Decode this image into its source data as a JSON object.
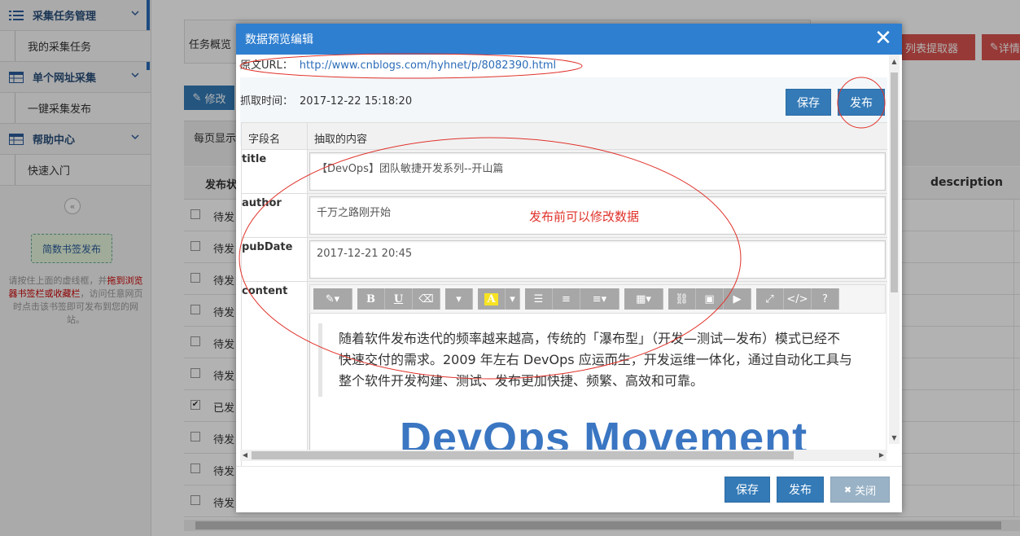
{
  "sidebar": {
    "groups": [
      {
        "label": "采集任务管理",
        "icon": "list-icon",
        "items": [
          "我的采集任务"
        ]
      },
      {
        "label": "单个网址采集",
        "icon": "table-icon",
        "items": [
          "一键采集发布"
        ]
      },
      {
        "label": "帮助中心",
        "icon": "table-icon",
        "items": [
          "快速入门"
        ]
      }
    ],
    "collapse_glyph": "«",
    "bookmark_button": "简数书签发布",
    "bookmark_tip_pre": "请按住上面的虚线框，并",
    "bookmark_tip_red": "拖到浏览器书签栏或收藏栏",
    "bookmark_tip_post": "，访问任意网页时点击该书签即可发布到您的网站。"
  },
  "background": {
    "tab_overview": "任务概览",
    "list_extractor_button": "列表提取器",
    "detail_button": "详情",
    "edit_button": "修改",
    "per_page": "每页显示",
    "header_status": "发布状",
    "header_description": "description",
    "rows": [
      {
        "status": "待发",
        "checked": false
      },
      {
        "status": "待发",
        "checked": false
      },
      {
        "status": "待发",
        "checked": false
      },
      {
        "status": "待发",
        "checked": false
      },
      {
        "status": "待发",
        "checked": false
      },
      {
        "status": "待发",
        "checked": false
      },
      {
        "status": "已发",
        "checked": true
      },
      {
        "status": "待发",
        "checked": false
      },
      {
        "status": "待发",
        "checked": false
      },
      {
        "status": "待发",
        "checked": false
      }
    ]
  },
  "modal": {
    "title": "数据预览编辑",
    "close_glyph": "✕",
    "url_label": "原文URL：",
    "url": "http://www.cnblogs.com/hyhnet/p/8082390.html",
    "fetch_label": "抓取时间：",
    "fetch_time": "2017-12-22 15:18:20",
    "save_label": "保存",
    "publish_label": "发布",
    "close_label": "关闭",
    "close_button_glyph": "✖",
    "col_field": "字段名",
    "col_content": "抽取的内容",
    "fields": [
      {
        "name": "title",
        "value": "【DevOps】团队敏捷开发系列--开山篇"
      },
      {
        "name": "author",
        "value": "千万之路刚开始"
      },
      {
        "name": "pubDate",
        "value": "2017-12-21 20:45"
      }
    ],
    "content_field": {
      "name": "content",
      "paragraph_lines": [
        "随着软件发布迭代的频率越来越高，传统的「瀑布型」（开发—测试—发布）模式已经不",
        "快速交付的需求。2009 年左右 DevOps 应运而生，开发运维一体化，通过自动化工具与",
        "整个软件开发构建、测试、发布更加快捷、频繁、高效和可靠。"
      ],
      "image_text": "DevOps Movement"
    },
    "toolbar": [
      {
        "name": "magic-wand-icon",
        "glyph": "✎▾"
      },
      {
        "name": "bold-icon",
        "glyph": "B"
      },
      {
        "name": "underline-icon",
        "glyph": "U"
      },
      {
        "name": "eraser-icon",
        "glyph": "⌫"
      },
      {
        "name": "font-dropdown-icon",
        "glyph": "▾"
      },
      {
        "name": "highlight-icon",
        "glyph": "A"
      },
      {
        "name": "highlight-dropdown-icon",
        "glyph": "▾"
      },
      {
        "name": "unordered-list-icon",
        "glyph": "☰"
      },
      {
        "name": "ordered-list-icon",
        "glyph": "≡"
      },
      {
        "name": "align-icon",
        "glyph": "≡▾"
      },
      {
        "name": "table-icon",
        "glyph": "▦▾"
      },
      {
        "name": "link-icon",
        "glyph": "⛓"
      },
      {
        "name": "image-icon",
        "glyph": "▣"
      },
      {
        "name": "video-icon",
        "glyph": "▶"
      },
      {
        "name": "fullscreen-icon",
        "glyph": "⤢"
      },
      {
        "name": "code-view-icon",
        "glyph": "</>"
      },
      {
        "name": "help-icon",
        "glyph": "?"
      }
    ]
  },
  "annotation": {
    "text": "发布前可以修改数据",
    "color": "#e0322a"
  },
  "colors": {
    "primary": "#337ab7",
    "modal_header": "#2f7fd0",
    "danger": "#d9534f",
    "annotation_red": "#e0322a"
  }
}
